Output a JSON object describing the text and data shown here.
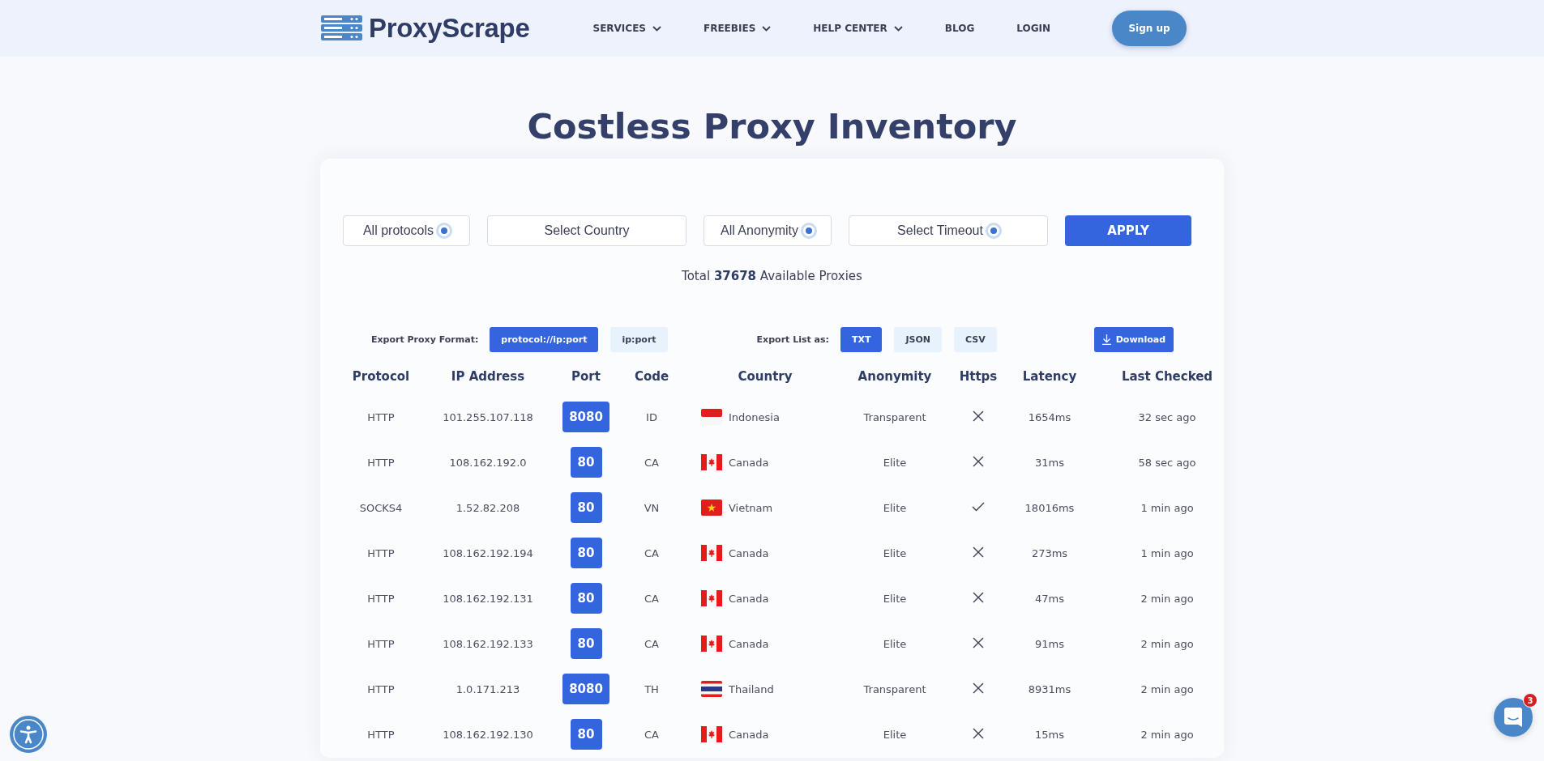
{
  "header": {
    "logo_text": "ProxyScrape",
    "nav": [
      {
        "label": "SERVICES",
        "has_caret": true
      },
      {
        "label": "FREEBIES",
        "has_caret": true
      },
      {
        "label": "HELP CENTER",
        "has_caret": true
      },
      {
        "label": "BLOG",
        "has_caret": false
      },
      {
        "label": "LOGIN",
        "has_caret": false
      }
    ],
    "signup": "Sign up"
  },
  "title": "Costless Proxy Inventory",
  "filters": [
    {
      "value": "All protocols",
      "indicator": true
    },
    {
      "value": "Select Country",
      "indicator": false
    },
    {
      "value": "All Anonymity",
      "indicator": true
    },
    {
      "value": "Select Timeout",
      "indicator": true
    }
  ],
  "apply": "APPLY",
  "total": "Total **37678** Available Proxies",
  "export": {
    "format_label": "Export Proxy Format:",
    "formats": [
      {
        "label": "protocol://ip:port",
        "selected": true
      },
      {
        "label": "ip:port",
        "selected": false
      }
    ],
    "list_label": "Export List as:",
    "lists": [
      {
        "label": "TXT",
        "selected": true
      },
      {
        "label": "JSON",
        "selected": false
      },
      {
        "label": "CSV",
        "selected": false
      }
    ],
    "download": "Download"
  },
  "table": {
    "columns": [
      "Protocol",
      "IP Address",
      "Port",
      "Code",
      "Country",
      "Anonymity",
      "Https",
      "Latency",
      "Last Checked"
    ],
    "rows": [
      {
        "protocol": "HTTP",
        "ip": "101.255.107.118",
        "port": "8080",
        "code": "ID",
        "kind": "id",
        "country": "Indonesia",
        "anonymity": "Transparent",
        "https": false,
        "latency": "1654ms",
        "last_checked": "32 sec ago"
      },
      {
        "protocol": "HTTP",
        "ip": "108.162.192.0",
        "port": "80",
        "code": "CA",
        "kind": "ca",
        "country": "Canada",
        "anonymity": "Elite",
        "https": false,
        "latency": "31ms",
        "last_checked": "58 sec ago"
      },
      {
        "protocol": "SOCKS4",
        "ip": "1.52.82.208",
        "port": "80",
        "code": "VN",
        "kind": "vn",
        "country": "Vietnam",
        "anonymity": "Elite",
        "https": true,
        "latency": "18016ms",
        "last_checked": "1 min ago"
      },
      {
        "protocol": "HTTP",
        "ip": "108.162.192.194",
        "port": "80",
        "code": "CA",
        "kind": "ca",
        "country": "Canada",
        "anonymity": "Elite",
        "https": false,
        "latency": "273ms",
        "last_checked": "1 min ago"
      },
      {
        "protocol": "HTTP",
        "ip": "108.162.192.131",
        "port": "80",
        "code": "CA",
        "kind": "ca",
        "country": "Canada",
        "anonymity": "Elite",
        "https": false,
        "latency": "47ms",
        "last_checked": "2 min ago"
      },
      {
        "protocol": "HTTP",
        "ip": "108.162.192.133",
        "port": "80",
        "code": "CA",
        "kind": "ca",
        "country": "Canada",
        "anonymity": "Elite",
        "https": false,
        "latency": "91ms",
        "last_checked": "2 min ago"
      },
      {
        "protocol": "HTTP",
        "ip": "1.0.171.213",
        "port": "8080",
        "code": "TH",
        "kind": "th",
        "country": "Thailand",
        "anonymity": "Transparent",
        "https": false,
        "latency": "8931ms",
        "last_checked": "2 min ago"
      },
      {
        "protocol": "HTTP",
        "ip": "108.162.192.130",
        "port": "80",
        "code": "CA",
        "kind": "ca",
        "country": "Canada",
        "anonymity": "Elite",
        "https": false,
        "latency": "15ms",
        "last_checked": "2 min ago"
      }
    ]
  },
  "chat": {
    "badge": "3"
  }
}
